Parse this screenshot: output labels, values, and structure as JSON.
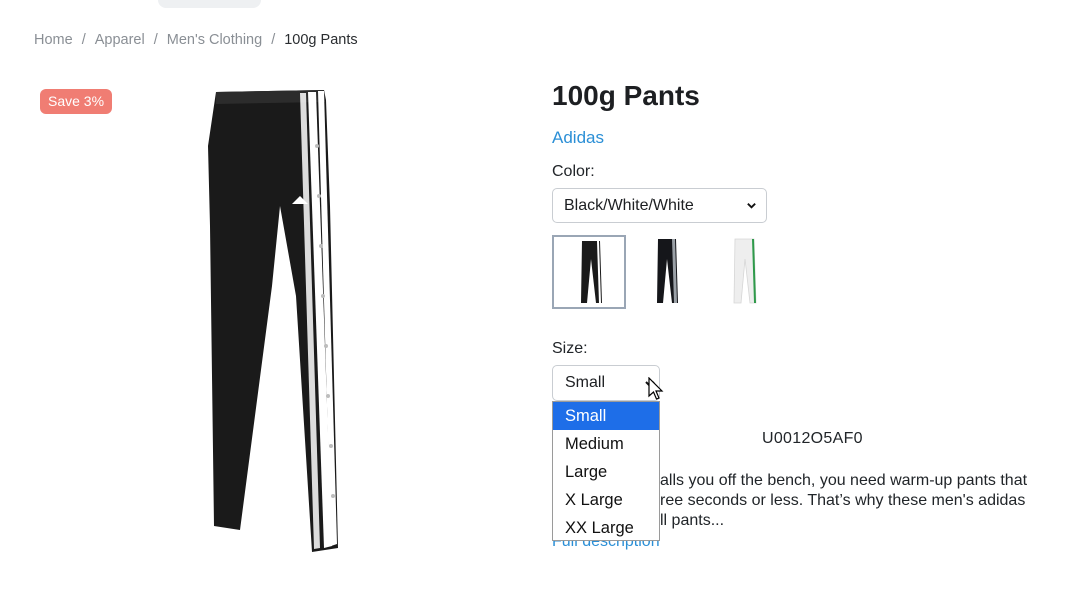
{
  "breadcrumb": {
    "items": [
      "Home",
      "Apparel",
      "Men's Clothing",
      "100g Pants"
    ],
    "separator": "/"
  },
  "product": {
    "badge": "Save 3%",
    "main_image_icon": "pants-product-image",
    "title": "100g Pants",
    "brand": "Adidas",
    "color_label": "Color:",
    "color_selected": "Black/White/White",
    "swatches": [
      {
        "icon": "pants-black-white-thumb",
        "selected": true
      },
      {
        "icon": "pants-black-grey-thumb",
        "selected": false
      },
      {
        "icon": "pants-white-green-thumb",
        "selected": false
      }
    ],
    "size_label": "Size:",
    "size_selected": "Small",
    "size_options": [
      "Small",
      "Medium",
      "Large",
      "X Large",
      "XX Large"
    ],
    "sku": "U0012O5AF0",
    "description_visible": [
      "alls you off the bench, you need warm-up pants that",
      "ree seconds or less. That’s why these men's adidas",
      "ll pants..."
    ],
    "full_description_link": "Full description"
  },
  "colors": {
    "link": "#2b8fd6",
    "badge": "#f07d73",
    "highlight": "#1e6ee8"
  }
}
